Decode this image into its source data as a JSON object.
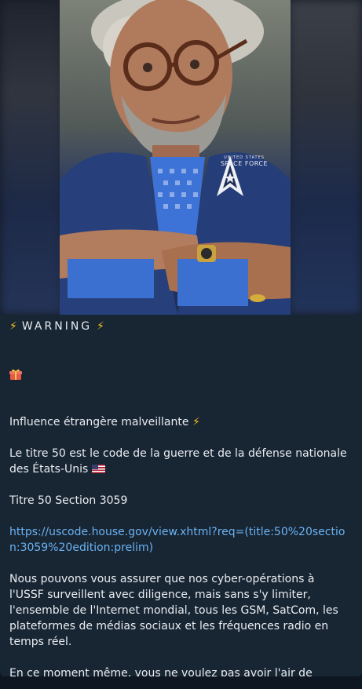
{
  "post": {
    "image": {
      "logo_small": "UNITED STATES",
      "logo_big": "SPACE FORCE"
    },
    "warning": "WARNING",
    "heading": "Influence étrangère malveillante",
    "para1": "Le titre 50 est le code de la guerre et de la défense nationale des États-Unis",
    "section": "Titre 50 Section 3059",
    "link": "https://uscode.house.gov/view.xhtml?req=(title:50%20section:3059%20edition:prelim)",
    "para2": "Nous pouvons vous assurer que nos cyber-opérations à l'USSF surveillent avec diligence, mais sans s'y limiter, l'ensemble de l'Internet mondial, tous les GSM, SatCom, les plateformes de médias sociaux et les fréquences radio en temps réel.",
    "para3": "En ce moment même, vous ne voulez pas avoir l'air de quelqu'un qui travaille pour des étrangers afin d'interférer et d'influencer.",
    "icons": [
      "lightning-icon",
      "gift-icon",
      "us-flag-icon"
    ]
  },
  "colors": {
    "background": "#0e1621",
    "bubble": "#182533",
    "text": "#e9edf1",
    "link": "#6ab3f3",
    "lightning": "#f7c21a"
  }
}
